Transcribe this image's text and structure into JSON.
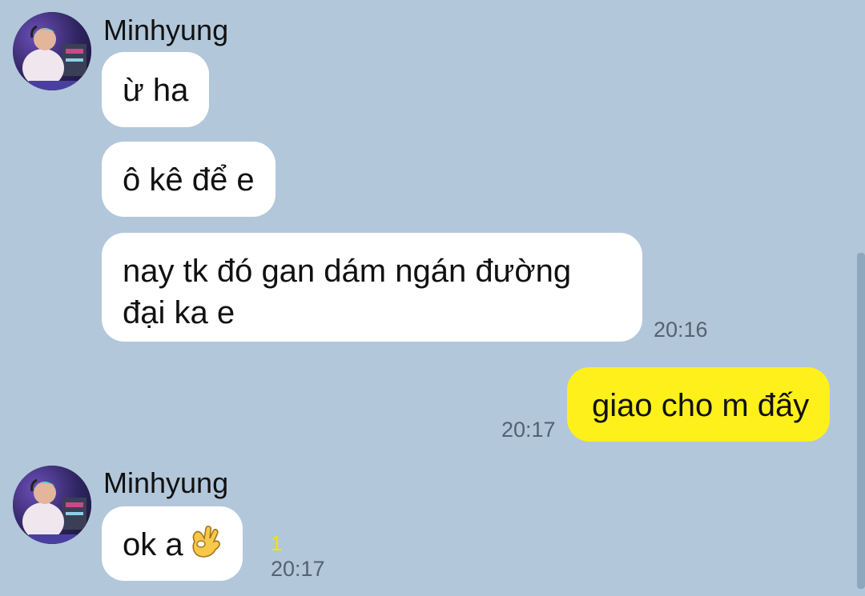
{
  "messages": {
    "group1": {
      "sender": "Minhyung",
      "bubbles": [
        "ừ ha",
        "ô kê để e",
        "nay tk đó gan dám ngán đường đại ka e"
      ],
      "time": "20:16"
    },
    "outgoing": {
      "text": "giao cho m đấy",
      "time": "20:17"
    },
    "group2": {
      "sender": "Minhyung",
      "text": "ok a",
      "emoji": "ok-hand-emoji",
      "unread_count": "1",
      "time": "20:17"
    }
  },
  "colors": {
    "background": "#b2c7da",
    "incoming_bubble": "#ffffff",
    "outgoing_bubble": "#fef01b",
    "unread": "#f2e400",
    "timestamp": "#556270"
  }
}
